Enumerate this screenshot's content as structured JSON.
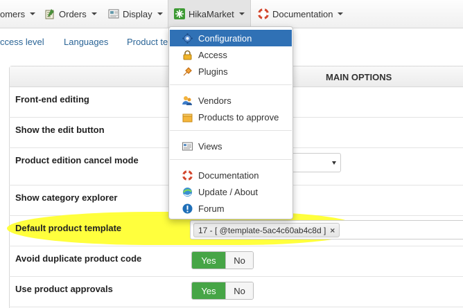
{
  "menubar": {
    "items": [
      {
        "label": "omers"
      },
      {
        "label": "Orders"
      },
      {
        "label": "Display"
      },
      {
        "label": "HikaMarket"
      },
      {
        "label": "Documentation"
      }
    ]
  },
  "subtabs": [
    "ccess level",
    "Languages",
    "Product te"
  ],
  "panel": {
    "title": "MAIN OPTIONS"
  },
  "rows": [
    {
      "label": "Front-end editing"
    },
    {
      "label": "Show the edit button"
    },
    {
      "label": "Product edition cancel mode"
    },
    {
      "label": "Show category explorer"
    },
    {
      "label": "Default product template"
    },
    {
      "label": "Avoid duplicate product code"
    },
    {
      "label": "Use product approvals"
    }
  ],
  "template_tag": {
    "value": "17 - [ @template-5ac4c60ab4c8d ]",
    "remove_symbol": "×"
  },
  "toggles": {
    "yes": "Yes",
    "no": "No"
  },
  "dropdown": {
    "items": [
      {
        "label": "Configuration",
        "icon": "gear-icon"
      },
      {
        "label": "Access",
        "icon": "lock-icon"
      },
      {
        "label": "Plugins",
        "icon": "plugin-icon"
      },
      {
        "label": "Vendors",
        "icon": "vendors-icon"
      },
      {
        "label": "Products to approve",
        "icon": "box-icon"
      },
      {
        "label": "Views",
        "icon": "views-icon"
      },
      {
        "label": "Documentation",
        "icon": "lifebuoy-icon"
      },
      {
        "label": "Update / About",
        "icon": "update-icon"
      },
      {
        "label": "Forum",
        "icon": "info-icon"
      }
    ]
  },
  "colors": {
    "accent": "#3071b5",
    "yes": "#46a546",
    "highlight": "#ffff33",
    "link": "#2a6496"
  }
}
